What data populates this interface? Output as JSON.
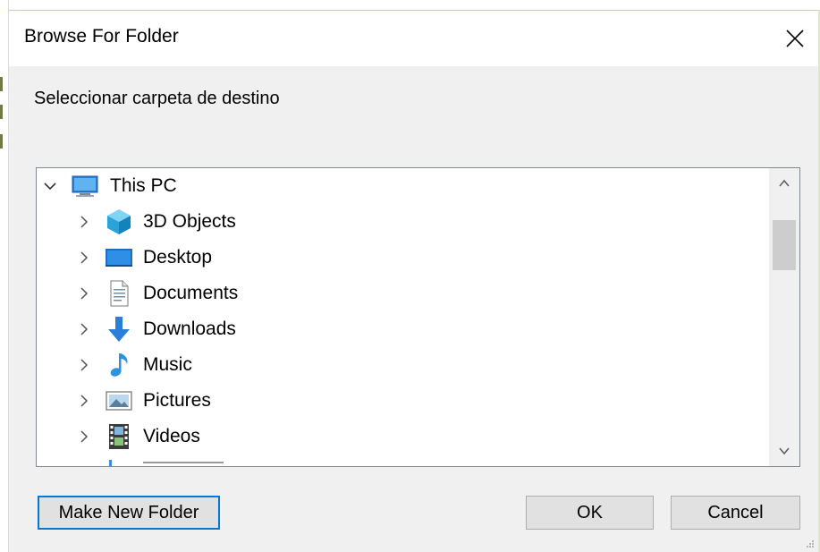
{
  "dialog": {
    "title": "Browse For Folder",
    "instruction": "Seleccionar carpeta de destino"
  },
  "tree": {
    "root": {
      "label": "This PC",
      "icon": "computer-icon",
      "expanded": true
    },
    "items": [
      {
        "label": "3D Objects",
        "icon": "3d-objects-icon"
      },
      {
        "label": "Desktop",
        "icon": "desktop-icon"
      },
      {
        "label": "Documents",
        "icon": "documents-icon"
      },
      {
        "label": "Downloads",
        "icon": "downloads-icon"
      },
      {
        "label": "Music",
        "icon": "music-icon"
      },
      {
        "label": "Pictures",
        "icon": "pictures-icon"
      },
      {
        "label": "Videos",
        "icon": "videos-icon"
      }
    ]
  },
  "buttons": {
    "make_new_folder": "Make New Folder",
    "ok": "OK",
    "cancel": "Cancel"
  },
  "colors": {
    "focus": "#0078d7",
    "button_face": "#e1e1e1",
    "dialog_face": "#f0f0f0"
  }
}
